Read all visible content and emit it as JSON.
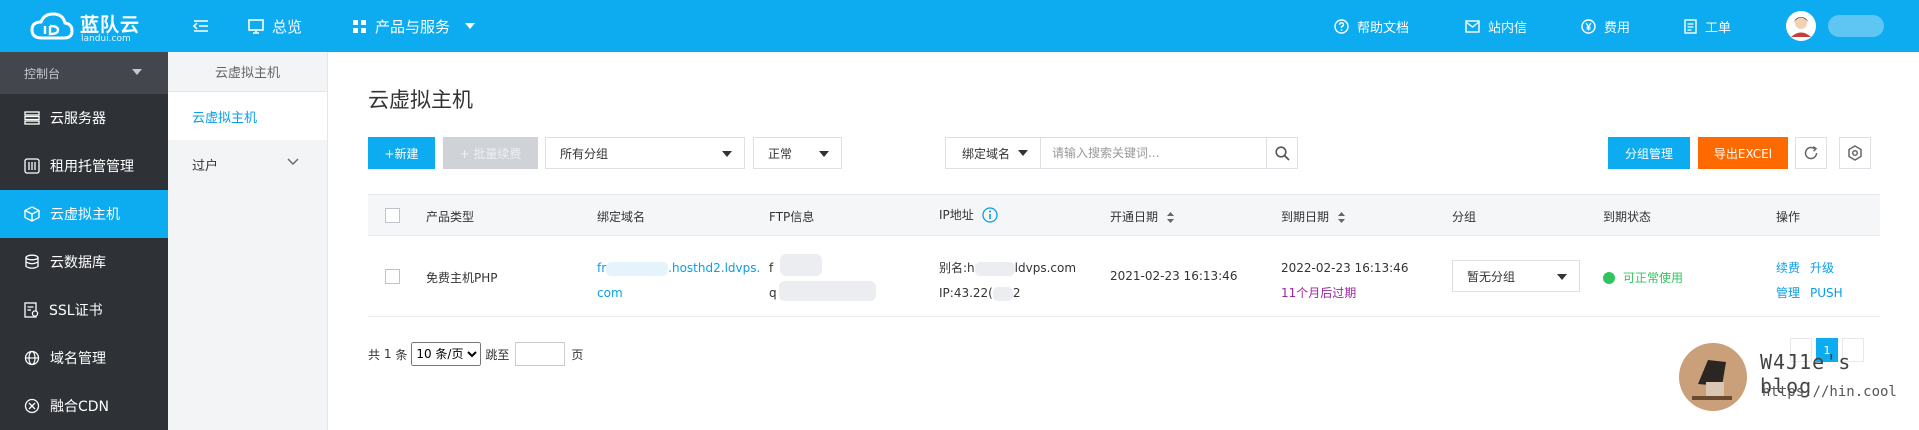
{
  "app": {
    "brand": "蓝队云",
    "domain": "landui.com"
  },
  "topnav": {
    "overview": "总览",
    "products": "产品与服务",
    "help": "帮助文档",
    "messages": "站内信",
    "billing": "费用",
    "tickets": "工单"
  },
  "sidebar": {
    "header": "控制台",
    "items": [
      {
        "label": "云服务器"
      },
      {
        "label": "租用托管管理"
      },
      {
        "label": "云虚拟主机"
      },
      {
        "label": "云数据库"
      },
      {
        "label": "SSL证书"
      },
      {
        "label": "域名管理"
      },
      {
        "label": "融合CDN"
      }
    ]
  },
  "subside": {
    "title": "云虚拟主机",
    "items": [
      {
        "label": "云虚拟主机"
      },
      {
        "label": "过户"
      }
    ]
  },
  "page": {
    "title": "云虚拟主机"
  },
  "toolbar": {
    "new": "+新建",
    "batch_renew": "+ 批量续费",
    "group_select": "所有分组",
    "status_select": "正常",
    "bind_domain": "绑定域名",
    "search_placeholder": "请输入搜索关键词...",
    "group_manage": "分组管理",
    "export": "导出EXCEl"
  },
  "table": {
    "headers": {
      "type": "产品类型",
      "domain": "绑定域名",
      "ftp": "FTP信息",
      "ip": "IP地址",
      "open_date": "开通日期",
      "expire_date": "到期日期",
      "group": "分组",
      "expire_status": "到期状态",
      "action": "操作"
    },
    "rows": [
      {
        "type": "免费主机PHP",
        "domain_a": "fr",
        "domain_b": ".hosthd2.ldvps.",
        "domain_c": "com",
        "ftp_a": "f",
        "ftp_b": "q",
        "alias_a": "别名:h",
        "alias_b": "ldvps.com",
        "ip_a": "IP:43.22(",
        "ip_b": "2",
        "open_date": "2021-02-23 16:13:46",
        "expire_date": "2022-02-23 16:13:46",
        "expire_note": "11个月后过期",
        "group": "暂无分组",
        "status": "可正常使用",
        "actions": {
          "renew": "续费",
          "upgrade": "升级",
          "manage": "管理",
          "push": "PUSH"
        }
      }
    ]
  },
  "pager": {
    "total_prefix": "共",
    "total": "1",
    "total_suffix": "条",
    "per_page": "10 条/页",
    "goto": "跳至",
    "page_unit": "页",
    "current": "1"
  },
  "watermark": {
    "title": "W4J1e's blog",
    "url": "https://hin.cool"
  },
  "colors": {
    "primary": "#0dabf0",
    "sidebar": "#2e3237",
    "export": "#ff6a00",
    "success": "#2fc55e",
    "warn": "#9b27a0"
  }
}
